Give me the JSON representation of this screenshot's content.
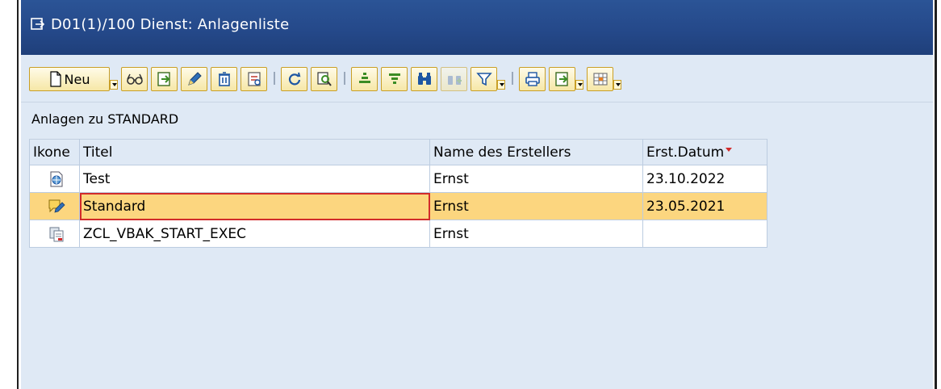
{
  "window": {
    "title": "D01(1)/100 Dienst: Anlagenliste"
  },
  "toolbar": {
    "new_label": "Neu",
    "buttons": [
      {
        "icon": "glasses-icon"
      },
      {
        "icon": "export-icon"
      },
      {
        "icon": "pencil-icon"
      },
      {
        "icon": "trash-icon"
      },
      {
        "icon": "attachment-icon"
      },
      {
        "icon": "refresh-icon"
      },
      {
        "icon": "details-icon"
      },
      {
        "icon": "sort-ascending-icon"
      },
      {
        "icon": "sort-descending-icon"
      },
      {
        "icon": "binoculars-icon"
      },
      {
        "icon": "find-next-icon"
      },
      {
        "icon": "filter-icon"
      },
      {
        "icon": "print-icon"
      },
      {
        "icon": "export-dropdown-icon"
      },
      {
        "icon": "layout-icon"
      }
    ]
  },
  "list": {
    "caption": "Anlagen zu STANDARD",
    "columns": [
      "Ikone",
      "Titel",
      "Name des Erstellers",
      "Erst.Datum"
    ],
    "sort_column": "Erst.Datum",
    "rows": [
      {
        "icon": "url-icon",
        "title": "Test",
        "creator": "Ernst",
        "date": "23.10.2022",
        "selected": false
      },
      {
        "icon": "note-icon",
        "title": "Standard",
        "creator": "Ernst",
        "date": "23.05.2021",
        "selected": true
      },
      {
        "icon": "binary-document-icon",
        "title": "ZCL_VBAK_START_EXEC",
        "creator": "Ernst",
        "date": "",
        "selected": false
      }
    ]
  },
  "colors": {
    "title_bar": "#2b5496",
    "selection": "#fcd67f",
    "background": "#dfe9f5",
    "button_border": "#c99f26"
  }
}
